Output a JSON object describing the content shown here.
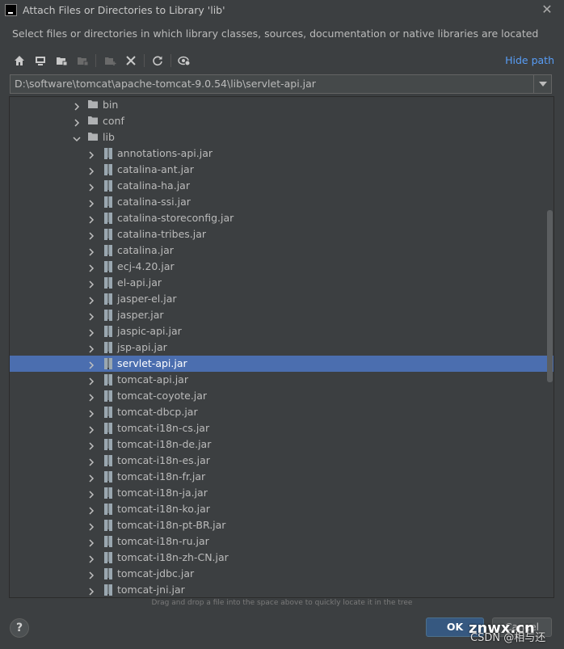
{
  "window": {
    "title": "Attach Files or Directories to Library 'lib'",
    "description": "Select files or directories in which library classes, sources, documentation or native libraries are located"
  },
  "toolbar": {
    "buttons": [
      {
        "icon": "home-icon",
        "enabled": true
      },
      {
        "icon": "desktop-icon",
        "enabled": true
      },
      {
        "icon": "project-folder-icon",
        "enabled": true
      },
      {
        "icon": "module-folder-icon",
        "enabled": false
      },
      {
        "icon": "new-folder-icon",
        "enabled": false
      },
      {
        "icon": "delete-icon",
        "enabled": true
      },
      {
        "icon": "refresh-icon",
        "enabled": true
      },
      {
        "icon": "show-hidden-icon",
        "enabled": true
      }
    ],
    "hide_path_label": "Hide path"
  },
  "path": {
    "value": "D:\\software\\tomcat\\apache-tomcat-9.0.54\\lib\\servlet-api.jar"
  },
  "tree": {
    "folders": [
      {
        "label": "bin",
        "expanded": false
      },
      {
        "label": "conf",
        "expanded": false
      },
      {
        "label": "lib",
        "expanded": true
      }
    ],
    "jars": [
      "annotations-api.jar",
      "catalina-ant.jar",
      "catalina-ha.jar",
      "catalina-ssi.jar",
      "catalina-storeconfig.jar",
      "catalina-tribes.jar",
      "catalina.jar",
      "ecj-4.20.jar",
      "el-api.jar",
      "jasper-el.jar",
      "jasper.jar",
      "jaspic-api.jar",
      "jsp-api.jar",
      "servlet-api.jar",
      "tomcat-api.jar",
      "tomcat-coyote.jar",
      "tomcat-dbcp.jar",
      "tomcat-i18n-cs.jar",
      "tomcat-i18n-de.jar",
      "tomcat-i18n-es.jar",
      "tomcat-i18n-fr.jar",
      "tomcat-i18n-ja.jar",
      "tomcat-i18n-ko.jar",
      "tomcat-i18n-pt-BR.jar",
      "tomcat-i18n-ru.jar",
      "tomcat-i18n-zh-CN.jar",
      "tomcat-jdbc.jar",
      "tomcat-jni.jar"
    ],
    "selected": "servlet-api.jar"
  },
  "hint": "Drag and drop a file into the space above to quickly locate it in the tree",
  "footer": {
    "help_label": "?",
    "ok_label": "OK",
    "cancel_label": "Cancel"
  },
  "watermark": {
    "site": "znwx.cn",
    "credit": "CSDN @相与还"
  },
  "colors": {
    "background": "#3c3f41",
    "selection": "#4b6eaf",
    "link": "#589df6",
    "folder": "#afb1b3",
    "jar": "#9aa7b0"
  }
}
